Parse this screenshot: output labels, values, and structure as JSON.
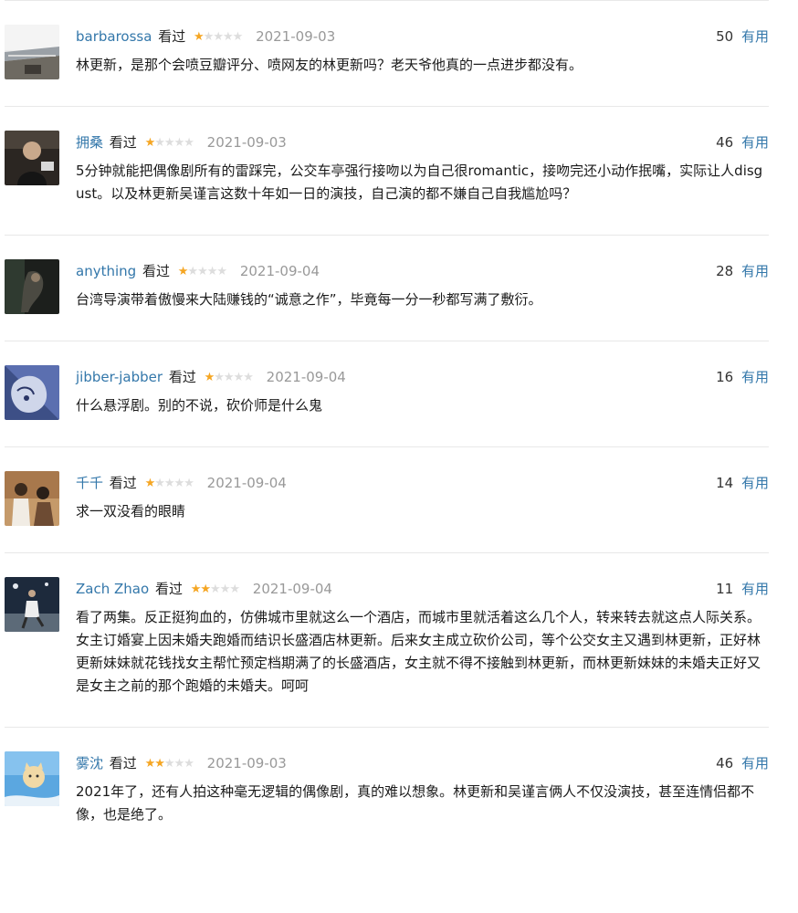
{
  "watched_label": "看过",
  "useful_label": "有用",
  "colors": {
    "link": "#3377aa",
    "star_on": "#f5a623",
    "star_off": "#dddddd",
    "date": "#999999",
    "divider": "#e8e8e8"
  },
  "comments": [
    {
      "user": "barbarossa",
      "rating": 1,
      "date": "2021-09-03",
      "votes": "50",
      "text": "林更新，是那个会喷豆瓣评分、喷网友的林更新吗？老天爷他真的一点进步都没有。",
      "avatar": "coastal-road-photo"
    },
    {
      "user": "拥桑",
      "rating": 1,
      "date": "2021-09-03",
      "votes": "46",
      "text": "5分钟就能把偶像剧所有的雷踩完，公交车亭强行接吻以为自己很romantic，接吻完还小动作抿嘴，实际让人disgust。以及林更新吴谨言这数十年如一日的演技，自己演的都不嫌自己自我尴尬吗？",
      "avatar": "man-portrait-photo"
    },
    {
      "user": "anything",
      "rating": 1,
      "date": "2021-09-04",
      "votes": "28",
      "text": "台湾导演带着傲慢来大陆赚钱的“诚意之作”，毕竟每一分一秒都写满了敷衍。",
      "avatar": "dark-film-still"
    },
    {
      "user": "jibber-jabber",
      "rating": 1,
      "date": "2021-09-04",
      "votes": "16",
      "text": "什么悬浮剧。别的不说，砍价师是什么鬼",
      "avatar": "blue-face-illustration"
    },
    {
      "user": "千千",
      "rating": 1,
      "date": "2021-09-04",
      "votes": "14",
      "text": "求一双没看的眼睛",
      "avatar": "vintage-couple-still"
    },
    {
      "user": "Zach Zhao",
      "rating": 2,
      "date": "2021-09-04",
      "votes": "11",
      "text": "看了两集。反正挺狗血的，仿佛城市里就这么一个酒店，而城市里就活着这么几个人，转来转去就这点人际关系。 女主订婚宴上因未婚夫跑婚而结识长盛酒店林更新。后来女主成立砍价公司，等个公交女主又遇到林更新，正好林更新妹妹就花钱找女主帮忙预定档期满了的长盛酒店，女主就不得不接触到林更新，而林更新妹妹的未婚夫正好又是女主之前的那个跑婚的未婚夫。呵呵",
      "avatar": "night-dancer-photo"
    },
    {
      "user": "雾沈",
      "rating": 2,
      "date": "2021-09-03",
      "votes": "46",
      "text": "2021年了，还有人拍这种毫无逻辑的偶像剧，真的难以想象。林更新和吴谨言俩人不仅没演技，甚至连情侣都不像，也是绝了。",
      "avatar": "sky-cat-illustration"
    }
  ]
}
